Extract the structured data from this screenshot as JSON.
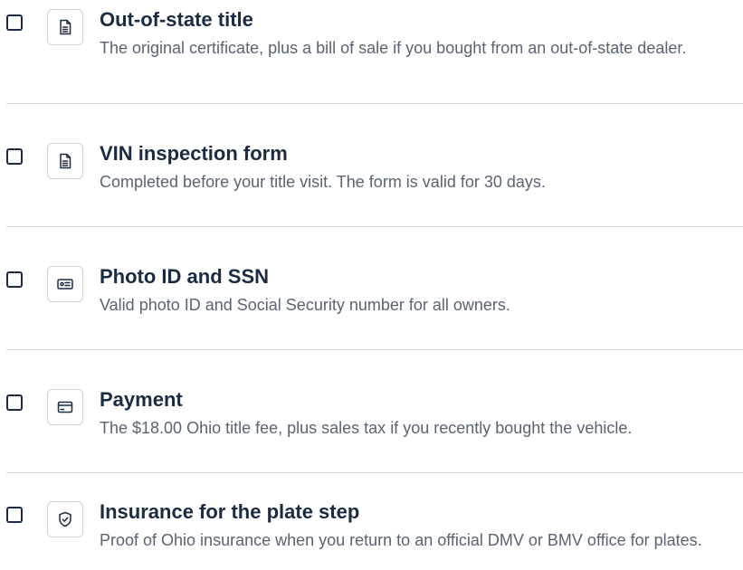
{
  "checklist": {
    "items": [
      {
        "title": "Out-of-state title",
        "description": "The original certificate, plus a bill of sale if you bought from an out-of-state dealer.",
        "icon": "document-icon",
        "checked": false
      },
      {
        "title": "VIN inspection form",
        "description": "Completed before your title visit. The form is valid for 30 days.",
        "icon": "document-icon",
        "checked": false
      },
      {
        "title": "Photo ID and SSN",
        "description": "Valid photo ID and Social Security number for all owners.",
        "icon": "id-card-icon",
        "checked": false
      },
      {
        "title": "Payment",
        "description": "The $18.00 Ohio title fee, plus sales tax if you recently bought the vehicle.",
        "icon": "credit-card-icon",
        "checked": false
      },
      {
        "title": "Insurance for the plate step",
        "description": "Proof of Ohio insurance when you return to an official DMV or BMV office for plates.",
        "icon": "shield-check-icon",
        "checked": false
      }
    ]
  },
  "colors": {
    "text_primary": "#1b2b41",
    "text_secondary": "#5a6472",
    "border": "#c9d3df",
    "divider": "#d5dbe2"
  }
}
